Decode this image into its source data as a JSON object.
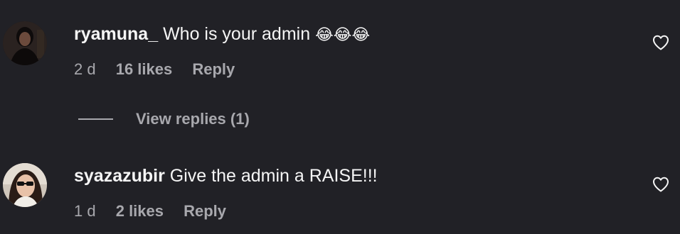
{
  "comments": [
    {
      "username": "ryamuna_",
      "text": "Who is your admin",
      "emoji": "😂😂😂",
      "time": "2 d",
      "likes": "16 likes",
      "reply_label": "Reply",
      "heart_icon": "heart-outline-icon"
    },
    {
      "username": "syazazubir",
      "text": "Give the admin a RAISE!!!",
      "emoji": "",
      "time": "1 d",
      "likes": "2 likes",
      "reply_label": "Reply",
      "heart_icon": "heart-outline-icon"
    }
  ],
  "view_replies": {
    "label": "View replies (1)"
  },
  "colors": {
    "background": "#212126",
    "primary_text": "#f5f5f5",
    "secondary_text": "#a8a8ad"
  }
}
